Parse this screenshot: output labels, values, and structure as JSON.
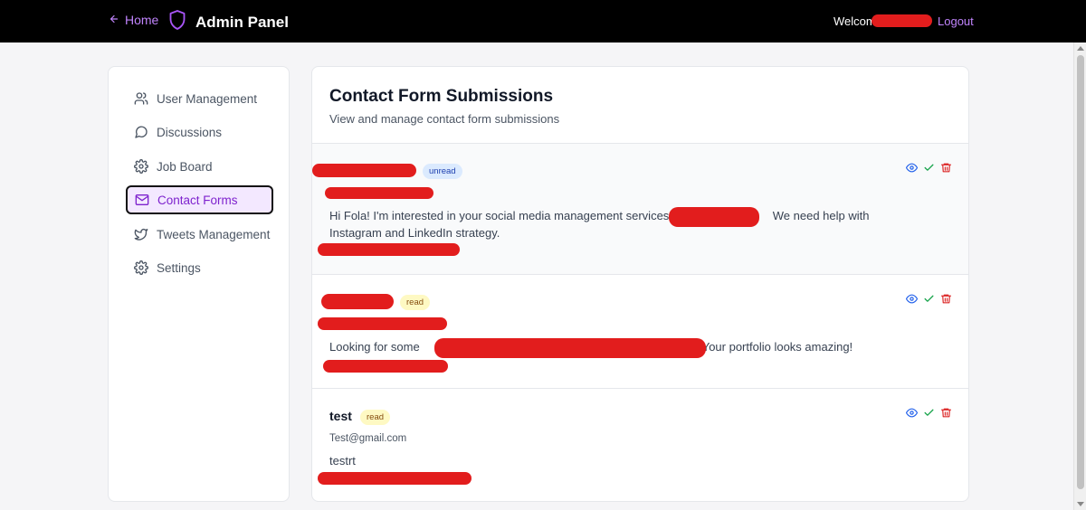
{
  "header": {
    "home_label": "Home",
    "title": "Admin Panel",
    "welcome_label": "Welcome",
    "logout_label": "Logout"
  },
  "sidebar": {
    "items": [
      {
        "label": "User Management",
        "icon": "users-icon"
      },
      {
        "label": "Discussions",
        "icon": "message-circle-icon"
      },
      {
        "label": "Job Board",
        "icon": "gear-icon"
      },
      {
        "label": "Contact Forms",
        "icon": "mail-icon",
        "active": true
      },
      {
        "label": "Tweets Management",
        "icon": "twitter-icon"
      },
      {
        "label": "Settings",
        "icon": "gear-icon"
      }
    ]
  },
  "main": {
    "title": "Contact Form Submissions",
    "subtitle": "View and manage contact form submissions"
  },
  "submissions": [
    {
      "name": "",
      "status": "unread",
      "email": "",
      "message_part1": "Hi Fola! I'm interested in your social media management services fo",
      "message_part2": "We need help with Instagram and LinkedIn strategy."
    },
    {
      "name": "",
      "status": "read",
      "email": "",
      "message_part1": "Looking for some",
      "message_part2": ". Your portfolio looks amazing!"
    },
    {
      "name": "test",
      "status": "read",
      "email": "Test@gmail.com",
      "message_part1": "testrt",
      "message_part2": ""
    }
  ],
  "colors": {
    "accent": "#c084fc",
    "active_bg": "#f3e8ff",
    "view": "#2563eb",
    "mark_read": "#16a34a",
    "delete": "#dc2626",
    "redaction": "#e21d1d"
  }
}
